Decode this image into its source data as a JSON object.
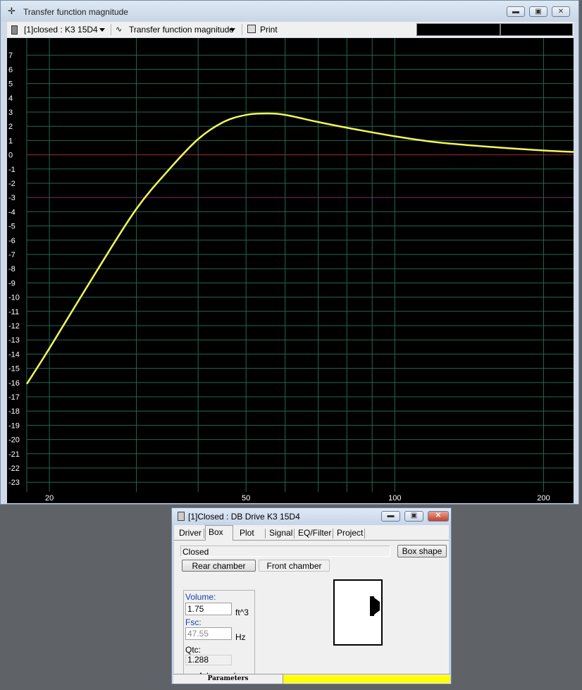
{
  "main_window": {
    "title": "Transfer function magnitude",
    "app_icon": "crosshair-icon",
    "toolbar": {
      "project_select": "[1]closed : K3 15D4",
      "plot_select": "Transfer function magnitude",
      "print_label": "Print"
    }
  },
  "colors": {
    "plot_bg": "#000000",
    "grid": "#1f6a4e",
    "curve": "#f5f558",
    "zero_line": "#a8282a",
    "minus3_line": "#7a2a6a",
    "axis_text": "#ffffff",
    "status_fill": "#ffff00"
  },
  "chart_data": {
    "type": "line",
    "title": "",
    "xlabel": "",
    "ylabel": "",
    "x_scale": "log",
    "xlim": [
      18,
      230
    ],
    "ylim": [
      -24,
      8
    ],
    "grid": true,
    "x_ticks": [
      20,
      50,
      100,
      200
    ],
    "y_ticks": [
      7,
      6,
      5,
      4,
      3,
      2,
      1,
      0,
      -1,
      -2,
      -3,
      -4,
      -5,
      -6,
      -7,
      -8,
      -9,
      -10,
      -11,
      -12,
      -13,
      -14,
      -15,
      -16,
      -17,
      -18,
      -19,
      -20,
      -21,
      -22,
      -23
    ],
    "reference_lines": [
      0,
      -3
    ],
    "series": [
      {
        "x": [
          18,
          20,
          25,
          30,
          35,
          40,
          45,
          50,
          55,
          60,
          70,
          80,
          100,
          120,
          150,
          200,
          230
        ],
        "y": [
          -16.1,
          -13.6,
          -8.1,
          -3.8,
          -1.0,
          1.1,
          2.3,
          2.8,
          2.9,
          2.8,
          2.3,
          1.9,
          1.3,
          0.9,
          0.6,
          0.3,
          0.2
        ]
      }
    ]
  },
  "dialog": {
    "title": "[1]Closed : DB Drive  K3 15D4",
    "tabs": [
      "Driver",
      "Box",
      "Plot",
      "Signal",
      "EQ/Filter",
      "Project"
    ],
    "active_tab": "Box",
    "box_type": "Closed",
    "box_shape_button": "Box shape",
    "rear_chamber_button": "Rear chamber",
    "front_chamber_button": "Front chamber",
    "volume_label": "Volume:",
    "volume_value": "1.75",
    "volume_unit": "ft^3",
    "fsc_label": "Fsc:",
    "fsc_value": "47.55",
    "fsc_unit": "Hz",
    "qtc_label": "Qtc:",
    "qtc_value": "1.288",
    "advanced_button": "Advanced->",
    "status_label": "Parameters"
  }
}
